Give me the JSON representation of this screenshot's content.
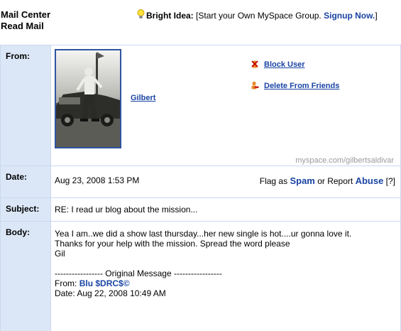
{
  "header": {
    "title_line1": "Mail Center",
    "title_line2": "Read Mail",
    "idea_label": "Bright Idea:",
    "idea_text": "[Start your Own MySpace Group.",
    "idea_link": "Signup Now.",
    "idea_close": "]"
  },
  "labels": {
    "from": "From:",
    "date": "Date:",
    "subject": "Subject:",
    "body": "Body:"
  },
  "from": {
    "sender_name": "Gilbert",
    "block_user": "Block User",
    "delete_friend": "Delete From Friends",
    "profile_url": "myspace.com/gilbertsaldivar"
  },
  "date": {
    "value": "Aug 23, 2008 1:53 PM",
    "flag_prefix": "Flag as",
    "spam": "Spam",
    "or_report": "or Report",
    "abuse": "Abuse",
    "help": "[?]"
  },
  "subject": {
    "value": "RE: I read ur blog about the mission..."
  },
  "body": {
    "lines": [
      "Yea I am..we did a show last thursday...her new single is hot....ur gonna love it.",
      "Thanks for your help with the mission. Spread the word please",
      "Gil"
    ],
    "original_header": "----------------- Original Message -----------------",
    "original_from_label": "From:",
    "original_from_name": "Blu $DRC$©",
    "original_date": "Date: Aug 22, 2008 10:49 AM"
  },
  "icons": {
    "bulb": "lightbulb-icon",
    "block": "block-user-icon",
    "delete": "delete-friend-icon"
  }
}
